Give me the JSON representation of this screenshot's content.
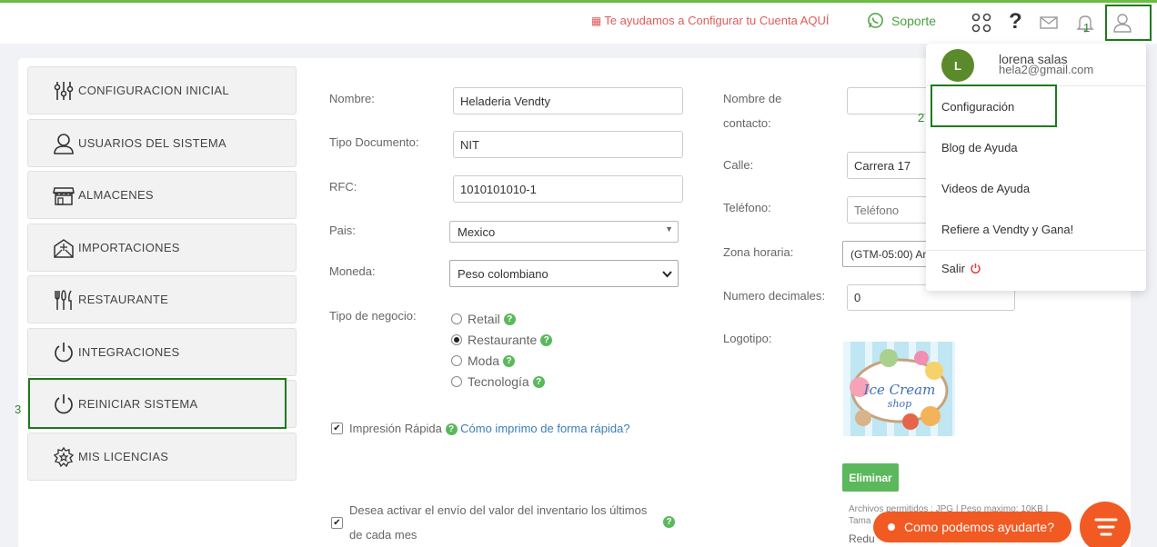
{
  "topbar": {
    "promo_text": "Te ayudamos a Configurar tu Cuenta AQUÍ",
    "support_label": "Soporte"
  },
  "steps": {
    "one": "1",
    "two": "2",
    "three": "3"
  },
  "sidebar": {
    "items": [
      {
        "label": "CONFIGURACION INICIAL"
      },
      {
        "label": "USUARIOS DEL SISTEMA"
      },
      {
        "label": "ALMACENES"
      },
      {
        "label": "IMPORTACIONES"
      },
      {
        "label": "RESTAURANTE"
      },
      {
        "label": "INTEGRACIONES"
      },
      {
        "label": "REINICIAR SISTEMA"
      },
      {
        "label": "MIS LICENCIAS"
      }
    ]
  },
  "form": {
    "nombre_label": "Nombre:",
    "nombre_value": "Heladeria Vendty",
    "tipo_doc_label": "Tipo Documento:",
    "tipo_doc_value": "NIT",
    "rfc_label": "RFC:",
    "rfc_value": "1010101010-1",
    "pais_label": "Pais:",
    "pais_value": "Mexico",
    "moneda_label": "Moneda:",
    "moneda_value": "Peso colombiano",
    "tipo_negocio_label": "Tipo de negocio:",
    "business_types": [
      "Retail",
      "Restaurante",
      "Moda",
      "Tecnología"
    ],
    "selected_business": "Restaurante",
    "impresion_label": "Impresión Rápida",
    "impresion_link": "Cómo imprimo de forma rápida?",
    "inventory_text_1": "Desea activar el envío del valor del inventario los últimos",
    "inventory_text_2": "de cada mes",
    "contacto_label_1": "Nombre de",
    "contacto_label_2": "contacto:",
    "calle_label": "Calle:",
    "calle_value": "Carrera 17",
    "telefono_label": "Teléfono:",
    "telefono_placeholder": "Teléfono",
    "zona_label": "Zona horaria:",
    "zona_value": "(GTM-05:00) Am",
    "decimales_label": "Numero decimales:",
    "decimales_value": "0",
    "logotipo_label": "Logotipo:",
    "logo_text_1": "Ice Cream",
    "logo_text_2": "shop",
    "eliminar_label": "Eliminar",
    "archivos_text": "Archivos permitidos : JPG | Peso maximo: 10KB |",
    "tama_text": "Tama",
    "redu_text": "Redu"
  },
  "user_menu": {
    "avatar_initial": "L",
    "name": "lorena salas",
    "email": "hela2@gmail.com",
    "items": [
      "Configuración",
      "Blog de Ayuda",
      "Videos de Ayuda",
      "Refiere a Vendty y Gana!"
    ],
    "logout_label": "Salir"
  },
  "chat": {
    "label": "Como podemos ayudarte?"
  },
  "colors": {
    "brand_green": "#6cbd45",
    "step_box": "#1e7a1e",
    "accent_orange": "#f15a22",
    "help_green": "#5cb85c"
  }
}
